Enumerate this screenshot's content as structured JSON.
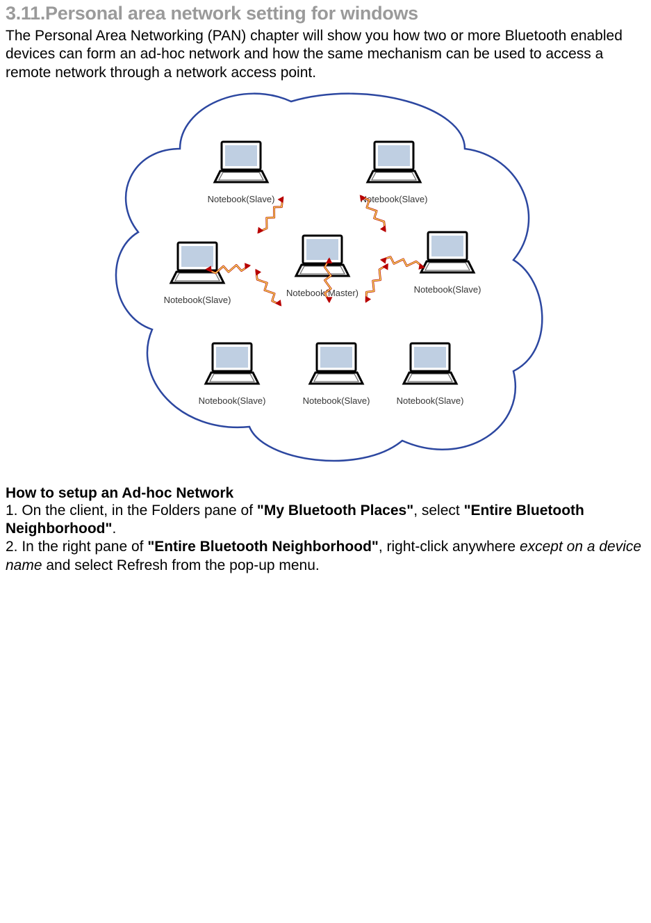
{
  "heading": "3.11.Personal area network setting for windows",
  "intro": "The Personal Area Networking (PAN) chapter will show you how two or more Bluetooth enabled devices can form an ad-hoc network and how the same mechanism can be used to access a remote network through a network access point.",
  "diagram": {
    "cloud_stroke": "#2C47A0",
    "signal_stroke": "#B80000",
    "signal_fill": "#FFFF66",
    "nodes": {
      "master": "Notebook(Master)",
      "slave": "Notebook(Slave)"
    }
  },
  "howto": {
    "title": "How to setup an Ad-hoc Network",
    "step1_a": "1. On the client, in the Folders pane of ",
    "step1_b": "\"My Bluetooth Places\"",
    "step1_c": ", select ",
    "step1_d": "\"Entire Bluetooth Neighborhood\"",
    "step1_e": ".",
    "step2_a": "2. In the right pane of ",
    "step2_b": "\"Entire Bluetooth Neighborhood\"",
    "step2_c": ", right-click anywhere ",
    "step2_d": "except on a device name",
    "step2_e": " and select Refresh from the pop-up menu."
  }
}
